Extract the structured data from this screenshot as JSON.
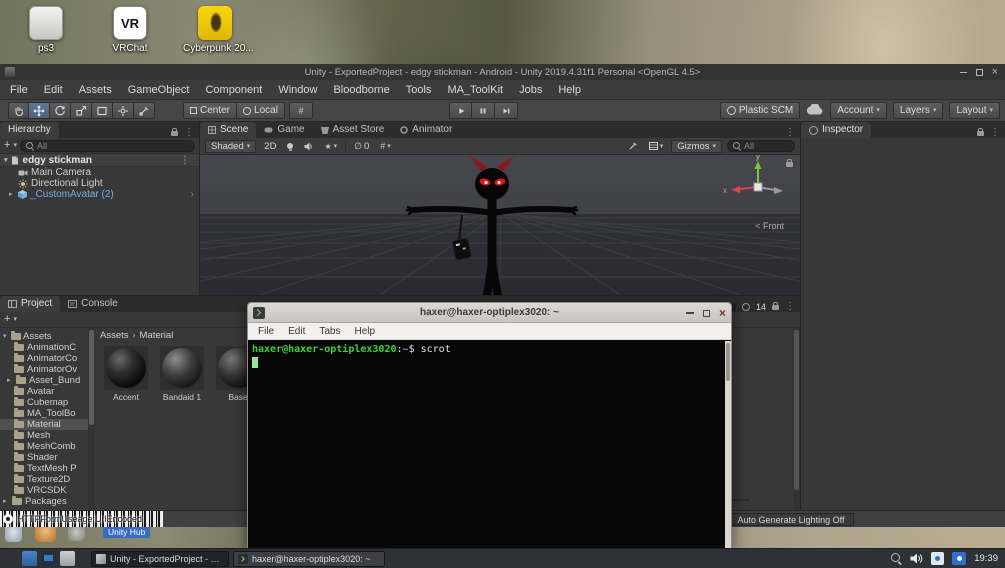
{
  "colors": {
    "prefab_blue": "#6eb1e6",
    "terminal_green": "#3bd23b",
    "selection_blue": "#2e6fd0",
    "eye_red": "#e21313",
    "horn_red": "#8f1616",
    "axis_green": "#79c832",
    "axis_red": "#d24a4a"
  },
  "glyphs": {
    "caret_down": "▾",
    "tri_right": "▸",
    "dots": "⋮",
    "plus": "+",
    "close": "×",
    "crumb_sep": "›",
    "grid": "#",
    "effects_star": "★",
    "hidden_eye": "∅"
  },
  "desktop": {
    "icons": [
      {
        "label": "ps3"
      },
      {
        "label": "VRChat",
        "badge": "VR"
      },
      {
        "label": "Cyberpunk 20..."
      }
    ],
    "unity_hub_label": "Unity Hub"
  },
  "unity": {
    "title": "Unity - ExportedProject - edgy stickman - Android - Unity 2019.4.31f1 Personal <OpenGL 4.5>",
    "menu": [
      "File",
      "Edit",
      "Assets",
      "GameObject",
      "Component",
      "Window",
      "Bloodborne",
      "Tools",
      "MA_ToolKit",
      "Jobs",
      "Help"
    ],
    "toolbar": {
      "pivot": "Center",
      "space": "Local",
      "plastic": "Plastic SCM",
      "account": "Account",
      "layers": "Layers",
      "layout": "Layout"
    },
    "hierarchy": {
      "tab": "Hierarchy",
      "search": "All",
      "scene_name": "edgy stickman",
      "items": [
        {
          "label": "Main Camera"
        },
        {
          "label": "Directional Light"
        },
        {
          "label": "_CustomAvatar (2)"
        }
      ]
    },
    "scene": {
      "tabs": [
        "Scene",
        "Game",
        "Asset Store",
        "Animator"
      ],
      "shading": "Shaded",
      "mode2d": "2D",
      "hidden_count": "0",
      "gizmos": "Gizmos",
      "search": "All",
      "view_label": "< Front",
      "axis_x": "x",
      "axis_y": "y"
    },
    "inspector": {
      "tab": "Inspector"
    },
    "project": {
      "tabs": [
        "Project",
        "Console"
      ],
      "badge": "14",
      "root": "Assets",
      "folders": [
        "AnimationC",
        "AnimatorCo",
        "AnimatorOv",
        "Asset_Bund",
        "Avatar",
        "Cubemap",
        "MA_ToolBo",
        "Material",
        "Mesh",
        "MeshComb",
        "Shader",
        "TextMesh P",
        "Texture2D",
        "VRCSDK"
      ],
      "packages": "Packages",
      "breadcrumb": [
        "Assets",
        "Material"
      ],
      "materials": [
        {
          "name": "Accent"
        },
        {
          "name": "Bandaid 1"
        },
        {
          "name": "Base"
        }
      ]
    },
    "status": {
      "message": "HTTPFormUseage:UrlEncoded",
      "lighting": "Auto Generate Lighting Off"
    }
  },
  "terminal": {
    "title": "haxer@haxer-optiplex3020: ~",
    "menu": [
      "File",
      "Edit",
      "Tabs",
      "Help"
    ],
    "prompt_user": "haxer@haxer-optiplex3020",
    "prompt_colon": ":",
    "prompt_path": "~",
    "prompt_symbol": "$",
    "command": "scrot"
  },
  "taskbar": {
    "windows": [
      {
        "label": "Unity - ExportedProject - edgy sti..."
      },
      {
        "label": "haxer@haxer-optiplex3020: ~"
      }
    ],
    "clock": "19:39"
  }
}
